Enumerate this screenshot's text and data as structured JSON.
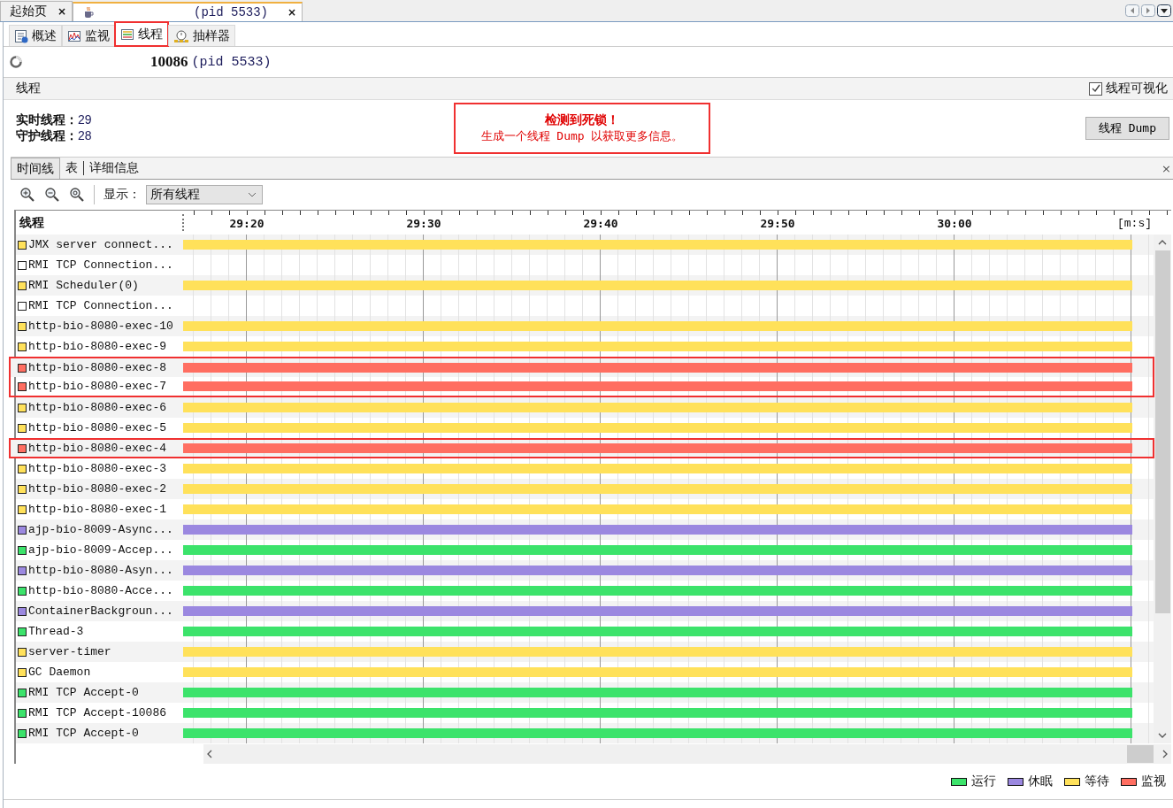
{
  "document_tabs": [
    {
      "label": "起始页",
      "selected": false,
      "close": "×"
    },
    {
      "label": "(pid 5533)",
      "selected": true,
      "close": "×"
    }
  ],
  "view_tabs": [
    {
      "label": "概述",
      "selected": false,
      "highlighted": false
    },
    {
      "label": "监视",
      "selected": false,
      "highlighted": false
    },
    {
      "label": "线程",
      "selected": true,
      "highlighted": true
    },
    {
      "label": "抽样器",
      "selected": false,
      "highlighted": false
    }
  ],
  "app_title": {
    "name": "10086",
    "pid": "(pid 5533)"
  },
  "section": {
    "title": "线程",
    "visualize": {
      "label": "线程可视化",
      "checked": true
    }
  },
  "stats": [
    {
      "label": "实时线程：",
      "value": "29"
    },
    {
      "label": "守护线程：",
      "value": "28"
    }
  ],
  "alert": {
    "title": "检测到死锁！",
    "message": "生成一个线程 Dump 以获取更多信息。"
  },
  "dump_button": "线程 Dump",
  "inner_tabs": [
    {
      "label": "时间线",
      "selected": true
    },
    {
      "label": "表",
      "selected": false
    },
    {
      "label": "详细信息",
      "selected": false
    }
  ],
  "inner_close": "×",
  "toolbar": {
    "show_label": "显示：",
    "filter": "所有线程"
  },
  "timeline": {
    "column": "线程",
    "ticks": [
      "29:20",
      "29:30",
      "29:40",
      "29:50",
      "30:00"
    ],
    "unit": "[m:s]",
    "rows": [
      {
        "name": "JMX server connect...",
        "color": "#ffe15a",
        "alive": true,
        "highlighted": false
      },
      {
        "name": "RMI TCP Connection...",
        "color": "#ffffff",
        "alive": false,
        "highlighted": false
      },
      {
        "name": "RMI Scheduler(0)",
        "color": "#ffe15a",
        "alive": true,
        "highlighted": false
      },
      {
        "name": "RMI TCP Connection...",
        "color": "#ffffff",
        "alive": false,
        "highlighted": false
      },
      {
        "name": "http-bio-8080-exec-10",
        "color": "#ffe15a",
        "alive": true,
        "highlighted": false
      },
      {
        "name": "http-bio-8080-exec-9",
        "color": "#ffe15a",
        "alive": true,
        "highlighted": false
      },
      {
        "name": "http-bio-8080-exec-8",
        "color": "#ff6e61",
        "alive": true,
        "highlighted": true
      },
      {
        "name": "http-bio-8080-exec-7",
        "color": "#ff6e61",
        "alive": true,
        "highlighted": true
      },
      {
        "name": "http-bio-8080-exec-6",
        "color": "#ffe15a",
        "alive": true,
        "highlighted": false
      },
      {
        "name": "http-bio-8080-exec-5",
        "color": "#ffe15a",
        "alive": true,
        "highlighted": false
      },
      {
        "name": "http-bio-8080-exec-4",
        "color": "#ff6e61",
        "alive": true,
        "highlighted": true
      },
      {
        "name": "http-bio-8080-exec-3",
        "color": "#ffe15a",
        "alive": true,
        "highlighted": false
      },
      {
        "name": "http-bio-8080-exec-2",
        "color": "#ffe15a",
        "alive": true,
        "highlighted": false
      },
      {
        "name": "http-bio-8080-exec-1",
        "color": "#ffe15a",
        "alive": true,
        "highlighted": false
      },
      {
        "name": "ajp-bio-8009-Async...",
        "color": "#9b88e0",
        "alive": true,
        "highlighted": false
      },
      {
        "name": "ajp-bio-8009-Accep...",
        "color": "#3ce36b",
        "alive": true,
        "highlighted": false
      },
      {
        "name": "http-bio-8080-Asyn...",
        "color": "#9b88e0",
        "alive": true,
        "highlighted": false
      },
      {
        "name": "http-bio-8080-Acce...",
        "color": "#3ce36b",
        "alive": true,
        "highlighted": false
      },
      {
        "name": "ContainerBackgroun...",
        "color": "#9b88e0",
        "alive": true,
        "highlighted": false
      },
      {
        "name": "Thread-3",
        "color": "#3ce36b",
        "alive": true,
        "highlighted": false
      },
      {
        "name": "server-timer",
        "color": "#ffe15a",
        "alive": true,
        "highlighted": false
      },
      {
        "name": "GC Daemon",
        "color": "#ffe15a",
        "alive": true,
        "highlighted": false
      },
      {
        "name": "RMI TCP Accept-0",
        "color": "#3ce36b",
        "alive": true,
        "highlighted": false
      },
      {
        "name": "RMI TCP Accept-10086",
        "color": "#3ce36b",
        "alive": true,
        "highlighted": false
      },
      {
        "name": "RMI TCP Accept-0",
        "color": "#3ce36b",
        "alive": true,
        "highlighted": false
      }
    ]
  },
  "legend": [
    {
      "label": "运行",
      "color": "#3ce36b"
    },
    {
      "label": "休眠",
      "color": "#9b88e0"
    },
    {
      "label": "等待",
      "color": "#ffe15a"
    },
    {
      "label": "监视",
      "color": "#ff6e61"
    }
  ]
}
